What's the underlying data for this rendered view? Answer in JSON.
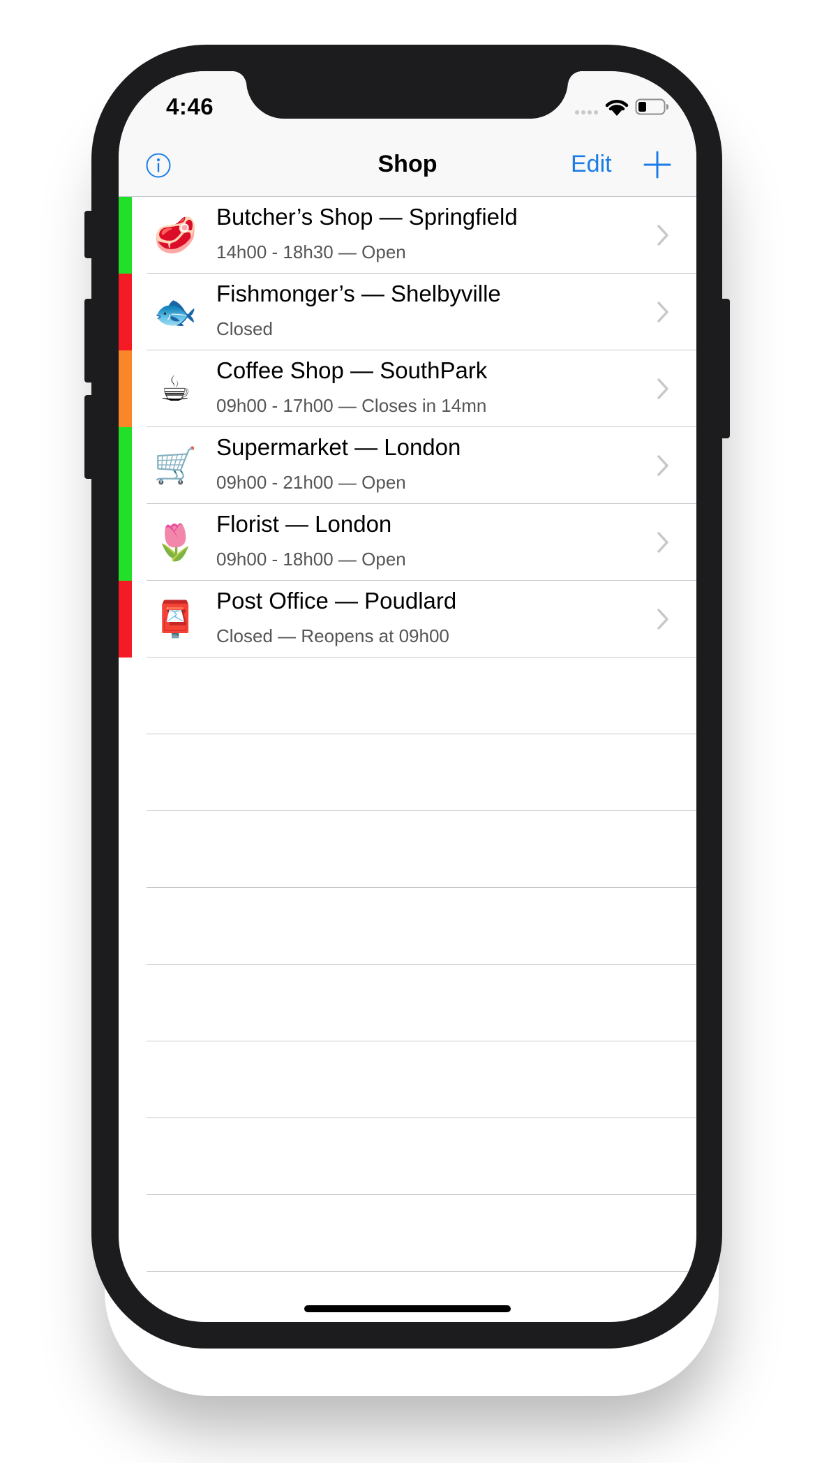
{
  "status_bar": {
    "time": "4:46"
  },
  "nav": {
    "title": "Shop",
    "edit_label": "Edit",
    "info_icon": "info-circle-icon",
    "add_icon": "plus-icon"
  },
  "colors": {
    "accent": "#1b7ce8",
    "open": "#22e02a",
    "closed": "#f51b24",
    "closing_soon": "#f98629"
  },
  "shops": [
    {
      "emoji": "🥩",
      "icon": "steak-icon",
      "title": "Butcher’s Shop — Springfield",
      "subtitle": "14h00 - 18h30 — Open",
      "status_color": "#22e02a"
    },
    {
      "emoji": "🐟",
      "icon": "fish-icon",
      "title": "Fishmonger’s — Shelbyville",
      "subtitle": "Closed",
      "status_color": "#f51b24"
    },
    {
      "emoji": "☕",
      "icon": "coffee-icon",
      "title": "Coffee Shop — SouthPark",
      "subtitle": "09h00 - 17h00 — Closes in 14mn",
      "status_color": "#f98629"
    },
    {
      "emoji": "🛒",
      "icon": "shopping-cart-icon",
      "title": "Supermarket — London",
      "subtitle": "09h00 - 21h00 — Open",
      "status_color": "#22e02a"
    },
    {
      "emoji": "🌷",
      "icon": "tulip-icon",
      "title": "Florist — London",
      "subtitle": "09h00 - 18h00 — Open",
      "status_color": "#22e02a"
    },
    {
      "emoji": "📮",
      "icon": "postbox-icon",
      "title": "Post Office — Poudlard",
      "subtitle": "Closed — Reopens at 09h00",
      "status_color": "#f51b24"
    }
  ]
}
